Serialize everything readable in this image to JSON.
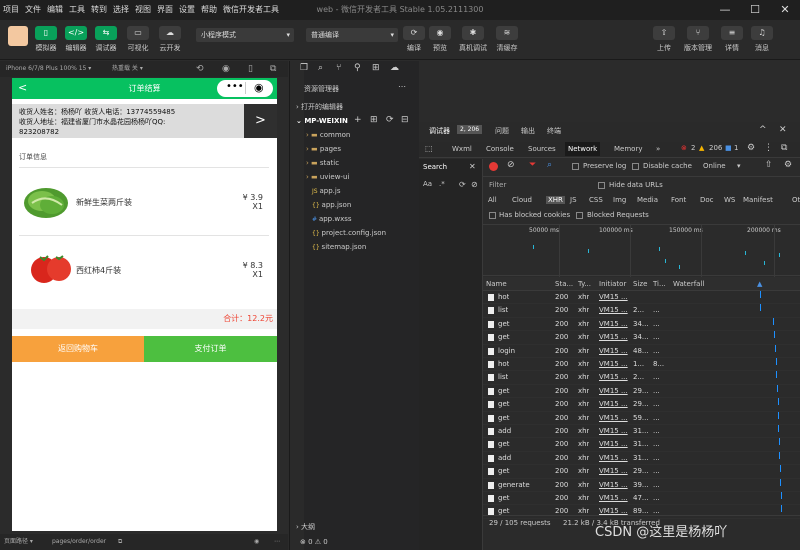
{
  "menubar": {
    "items": [
      "项目",
      "文件",
      "编辑",
      "工具",
      "转到",
      "选择",
      "视图",
      "界面",
      "设置",
      "帮助",
      "微信开发者工具"
    ],
    "title": "web - 微信开发者工具 Stable 1.05.2111300"
  },
  "toolbar": {
    "left": [
      {
        "label": "模拟器",
        "icon": "phone-icon"
      },
      {
        "label": "编辑器",
        "icon": "code-icon"
      },
      {
        "label": "调试器",
        "icon": "debug-icon"
      },
      {
        "label": "可视化",
        "icon": "visual-icon"
      },
      {
        "label": "云开发",
        "icon": "cloud-icon"
      }
    ],
    "mode_select": "小程序模式",
    "compile_select": "普通编译",
    "mid": [
      {
        "label": "编译"
      },
      {
        "label": "预览"
      },
      {
        "label": "真机调试"
      },
      {
        "label": "清缓存"
      }
    ],
    "right": [
      {
        "label": "上传"
      },
      {
        "label": "版本管理"
      },
      {
        "label": "详情"
      },
      {
        "label": "消息"
      }
    ]
  },
  "simulator": {
    "device": "iPhone 6/7/8 Plus 100% 15 ▾",
    "reload": "热重载 关 ▾",
    "path_label": "页面路径 ▾",
    "path": "pages/order/order"
  },
  "phone": {
    "title": "订单结算",
    "address_line1": "收货人姓名：杨杨吖   收货人电话：13774559485",
    "address_line2": "收货人地址：福建省厦门市水晶花园杨杨吖QQ:",
    "address_line3": "823208782",
    "arrow": ">",
    "order_label": "订单信息",
    "goods": [
      {
        "name": "新鲜生菜两斤装",
        "price": "¥ 3.9",
        "qty": "X1"
      },
      {
        "name": "西红柿4斤装",
        "price": "¥ 8.3",
        "qty": "X1"
      }
    ],
    "total": "合计：12.2元",
    "btn_back": "返回购物车",
    "btn_pay": "支付订单"
  },
  "explorer": {
    "title": "资源管理器",
    "open_editors": "打开的编辑器",
    "project": "MP-WEIXIN",
    "items": [
      {
        "name": "common",
        "type": "folder"
      },
      {
        "name": "pages",
        "type": "folder"
      },
      {
        "name": "static",
        "type": "folder"
      },
      {
        "name": "uview-ui",
        "type": "folder"
      },
      {
        "name": "app.js",
        "type": "js"
      },
      {
        "name": "app.json",
        "type": "json"
      },
      {
        "name": "app.wxss",
        "type": "wxss"
      },
      {
        "name": "project.config.json",
        "type": "json"
      },
      {
        "name": "sitemap.json",
        "type": "json"
      }
    ],
    "outline": "大纲",
    "status": "⊗ 0 ⚠ 0"
  },
  "devtools": {
    "top_tabs": [
      "调试器",
      "问题",
      "输出",
      "终端"
    ],
    "badge": "2, 206",
    "tabs": [
      "Wxml",
      "Console",
      "Sources",
      "Network",
      "Memory"
    ],
    "errors": "2",
    "warnings": "206",
    "info": "1",
    "search_label": "Search",
    "filter_placeholder": "Filter",
    "preserve_log": "Preserve log",
    "disable_cache": "Disable cache",
    "throttle": "Online",
    "hide_data_urls": "Hide data URLs",
    "types": [
      "All",
      "Cloud",
      "XHR",
      "JS",
      "CSS",
      "Img",
      "Media",
      "Font",
      "Doc",
      "WS",
      "Manifest",
      "Other"
    ],
    "has_blocked": "Has blocked cookies",
    "blocked_requests": "Blocked Requests",
    "ticks": [
      "50000 ms",
      "100000 ms",
      "150000 ms",
      "200000 ms"
    ],
    "columns": [
      "Name",
      "Sta...",
      "Ty...",
      "Initiator",
      "Size",
      "Ti...",
      "Waterfall"
    ],
    "rows": [
      {
        "name": "hot",
        "status": "200",
        "type": "xhr",
        "init": "VM15 ...",
        "size": "",
        "time": ""
      },
      {
        "name": "list",
        "status": "200",
        "type": "xhr",
        "init": "VM15 ...",
        "size": "2...",
        "time": "..."
      },
      {
        "name": "get",
        "status": "200",
        "type": "xhr",
        "init": "VM15 ...",
        "size": "34...",
        "time": "..."
      },
      {
        "name": "get",
        "status": "200",
        "type": "xhr",
        "init": "VM15 ...",
        "size": "34...",
        "time": "..."
      },
      {
        "name": "login",
        "status": "200",
        "type": "xhr",
        "init": "VM15 ...",
        "size": "48...",
        "time": "..."
      },
      {
        "name": "hot",
        "status": "200",
        "type": "xhr",
        "init": "VM15 ...",
        "size": "1...",
        "time": "8..."
      },
      {
        "name": "list",
        "status": "200",
        "type": "xhr",
        "init": "VM15 ...",
        "size": "2...",
        "time": "..."
      },
      {
        "name": "get",
        "status": "200",
        "type": "xhr",
        "init": "VM15 ...",
        "size": "29...",
        "time": "..."
      },
      {
        "name": "get",
        "status": "200",
        "type": "xhr",
        "init": "VM15 ...",
        "size": "29...",
        "time": "..."
      },
      {
        "name": "get",
        "status": "200",
        "type": "xhr",
        "init": "VM15 ...",
        "size": "59...",
        "time": "..."
      },
      {
        "name": "add",
        "status": "200",
        "type": "xhr",
        "init": "VM15 ...",
        "size": "31...",
        "time": "..."
      },
      {
        "name": "get",
        "status": "200",
        "type": "xhr",
        "init": "VM15 ...",
        "size": "31...",
        "time": "..."
      },
      {
        "name": "add",
        "status": "200",
        "type": "xhr",
        "init": "VM15 ...",
        "size": "31...",
        "time": "..."
      },
      {
        "name": "get",
        "status": "200",
        "type": "xhr",
        "init": "VM15 ...",
        "size": "29...",
        "time": "..."
      },
      {
        "name": "generate",
        "status": "200",
        "type": "xhr",
        "init": "VM15 ...",
        "size": "39...",
        "time": "..."
      },
      {
        "name": "get",
        "status": "200",
        "type": "xhr",
        "init": "VM15 ...",
        "size": "47...",
        "time": "..."
      },
      {
        "name": "get",
        "status": "200",
        "type": "xhr",
        "init": "VM15 ...",
        "size": "89...",
        "time": "..."
      }
    ],
    "summary": "29 / 105 requests",
    "summary2": "21.2 kB / 3.4 kB transferred",
    "watermark": "CSDN @这里是杨杨吖"
  }
}
